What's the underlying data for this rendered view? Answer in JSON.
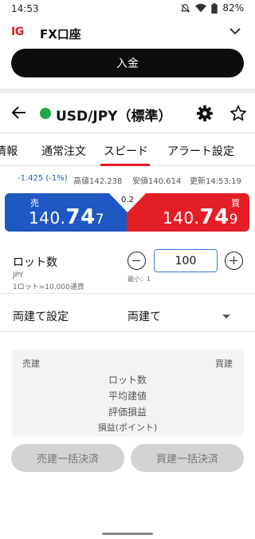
{
  "status_bar": {
    "time": "14:53",
    "battery": "82%",
    "icons": [
      "bell-off-icon",
      "wifi-icon",
      "battery-icon"
    ]
  },
  "account": {
    "logo": "IG",
    "name": "FX口座",
    "deposit_label": "入金"
  },
  "instrument": {
    "title": "USD/JPY（標準）",
    "status_color": "#1ea84a"
  },
  "tabs": [
    {
      "label": "情報"
    },
    {
      "label": "通常注文"
    },
    {
      "label": "スピード",
      "active": true
    },
    {
      "label": "アラート設定"
    }
  ],
  "quote": {
    "change": "-1.425 (-1%)",
    "high": "高値142.238",
    "low": "安値140.614",
    "updated": "更新14:53:19"
  },
  "prices": {
    "sell_label": "売",
    "buy_label": "買",
    "sell_prefix": "140.",
    "sell_big": "74",
    "sell_pip": "7",
    "buy_prefix": "140.",
    "buy_big": "74",
    "buy_pip": "9",
    "spread": "0.2",
    "sell_color": "#1f57c3",
    "buy_color": "#e41e26"
  },
  "lot": {
    "label": "ロット数",
    "unit": "JPY",
    "note": "1ロット=10,000通貨",
    "value": "100",
    "min_note": "最小：1"
  },
  "hedge": {
    "label": "両建て設定",
    "value": "両建て"
  },
  "position_panel": {
    "sell": "売建",
    "buy": "買建",
    "lot": "ロット数",
    "avg": "平均建値",
    "pl": "評価損益",
    "points": "損益(ポイント)"
  },
  "buttons": {
    "close_sell": "売建一括決済",
    "close_buy": "買建一括決済"
  }
}
